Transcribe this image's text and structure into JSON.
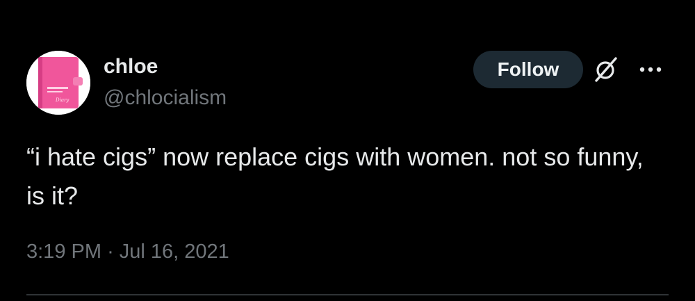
{
  "tweet": {
    "author": {
      "display_name": "chloe",
      "handle": "@chlocialism",
      "avatar_icon": "pink-diary-planner-avatar"
    },
    "follow_label": "Follow",
    "grok_icon": "grok-icon",
    "more_icon": "more-icon",
    "text": "“i hate cigs” now replace cigs with women. not so funny, is it?",
    "time": "3:19 PM",
    "separator": "·",
    "date": "Jul 16, 2021"
  },
  "colors": {
    "background": "#000000",
    "primary_text": "#e7e9ea",
    "secondary_text": "#71767b",
    "follow_button_bg": "#1d2a33",
    "divider": "#2f3336",
    "avatar_accent": "#f0569b"
  }
}
